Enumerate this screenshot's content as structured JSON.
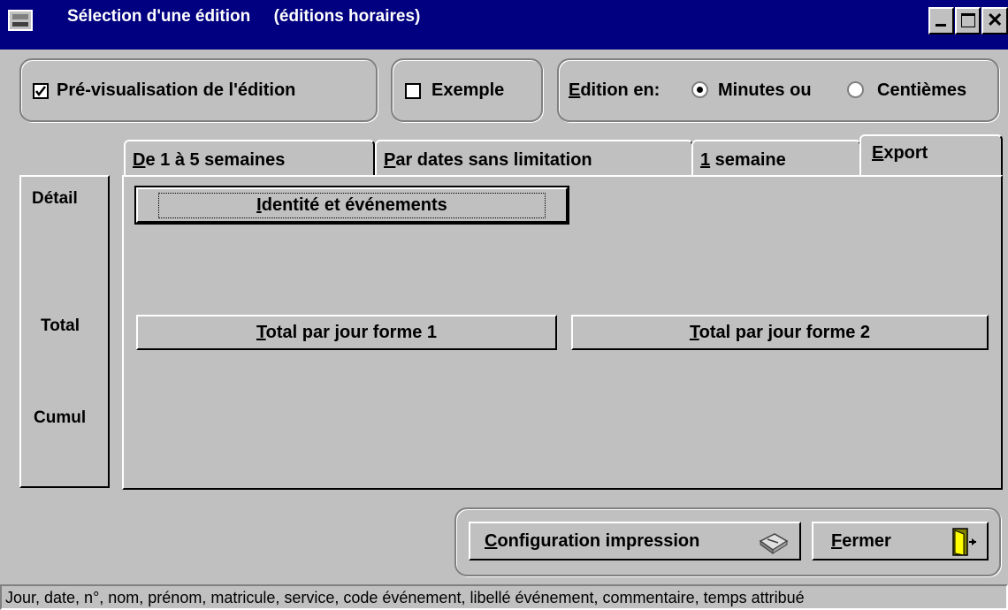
{
  "window": {
    "title": "Sélection d'une édition     (éditions horaires)"
  },
  "options": {
    "preview_label": "Pré-visualisation de l'édition",
    "example_label": "Exemple",
    "edition_label": "Edition en:",
    "minutes_label": "Minutes ou",
    "centiemes_label": "Centièmes"
  },
  "tabs": [
    {
      "label": "De 1 à 5 semaines"
    },
    {
      "label": "Par dates sans limitation"
    },
    {
      "label": "1 semaine"
    },
    {
      "label": "Export"
    }
  ],
  "sidebar": {
    "detail": "Détail",
    "total": "Total",
    "cumul": "Cumul"
  },
  "panel": {
    "identite_button": "Identité et événements",
    "total1_button": "Total par jour forme 1",
    "total2_button": "Total par jour forme 2"
  },
  "footer": {
    "config_button": "Configuration impression",
    "close_button": "Fermer"
  },
  "status": {
    "text": "Jour, date, n°, nom, prénom, matricule, service, code événement, libellé événement, commentaire, temps attribué"
  }
}
